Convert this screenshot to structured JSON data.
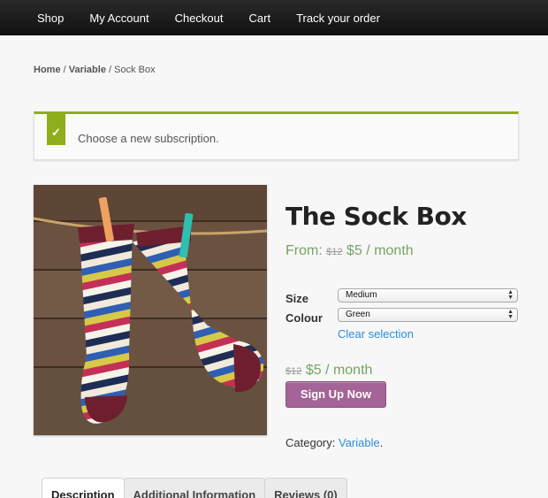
{
  "nav": {
    "items": [
      "Shop",
      "My Account",
      "Checkout",
      "Cart",
      "Track your order"
    ]
  },
  "breadcrumb": {
    "home": "Home",
    "category": "Variable",
    "current": "Sock Box",
    "separator": "/"
  },
  "notice": {
    "icon": "checkmark-icon",
    "check_glyph": "✓",
    "message": "Choose a new subscription.",
    "accent_color": "#8fae1b"
  },
  "product": {
    "image_icon": "striped-socks-image",
    "title": "The Sock Box",
    "price_prefix": "From:",
    "regular_price": "$12",
    "sale_price": "$5",
    "period": "/ month",
    "variations": {
      "size_label": "Size",
      "size_value": "Medium",
      "colour_label": "Colour",
      "colour_value": "Green",
      "clear_label": "Clear selection"
    },
    "variation_price": {
      "regular": "$12",
      "sale": "$5",
      "period": "/ month"
    },
    "signup_label": "Sign Up Now",
    "category_label": "Category:",
    "category_value": "Variable",
    "category_suffix": "."
  },
  "tabs": [
    "Description",
    "Additional Information",
    "Reviews (0)"
  ],
  "colors": {
    "price_green": "#77a464",
    "button_purple": "#a46497",
    "link_blue": "#2f8ed8"
  }
}
